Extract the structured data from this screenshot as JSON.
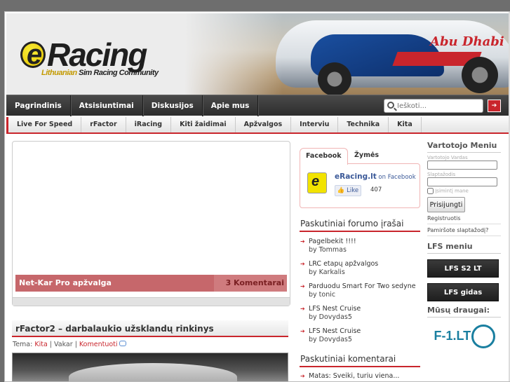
{
  "brand": {
    "logo_word": "Racing",
    "logo_letter": "e",
    "tagline_lt": "Lithuanian",
    "tagline_rest": " Sim Racing Community",
    "header_car_text": "Abu Dhabi",
    "accent_color": "#c9252c"
  },
  "main_nav": {
    "items": [
      "Pagrindinis",
      "Atsisiuntimai",
      "Diskusijos",
      "Apie mus"
    ]
  },
  "search": {
    "placeholder": "Ieškoti...",
    "button_icon": "arrow-right-icon"
  },
  "sub_nav": {
    "items": [
      "Live For Speed",
      "rFactor",
      "iRacing",
      "Kiti žaidimai",
      "Apžvalgos",
      "Interviu",
      "Technika",
      "Kita"
    ]
  },
  "slider": {
    "title": "Net-Kar Pro apžvalga",
    "comments": "3 Komentarai"
  },
  "post": {
    "title": "rFactor2 – darbalaukio užsklandų rinkinys",
    "meta_prefix": "Tema: ",
    "category": "Kita",
    "date": "Vakar",
    "comments_link": "Komentuoti"
  },
  "facebook": {
    "tab_active": "Facebook",
    "tab_other": "Žymės",
    "page_name": "eRacing.lt",
    "on_facebook": " on Facebook",
    "like_label": "Like",
    "like_count": "407"
  },
  "forum": {
    "title": "Paskutiniai forumo įrašai",
    "items": [
      {
        "topic": "Pagelbekit !!!!",
        "by": "by Tommas"
      },
      {
        "topic": "LRC etapų apžvalgos",
        "by": "by Karkalis"
      },
      {
        "topic": "Parduodu Smart For Two sedyne",
        "by": "by tonic"
      },
      {
        "topic": "LFS Nest Cruise",
        "by": "by Dovydas5"
      },
      {
        "topic": "LFS Nest Cruise",
        "by": "by Dovydas5"
      }
    ]
  },
  "comments": {
    "title": "Paskutiniai komentarai",
    "items": [
      {
        "text": "Matas: Sveiki, turiu viena..."
      }
    ]
  },
  "user_menu": {
    "title": "Vartotojo Meniu",
    "username_label": "Vartotojo Vardas",
    "password_label": "Slaptažodis",
    "remember_label": "Įsimintį mane",
    "login_button": "Prisijungti",
    "register_link": "Registruotis",
    "forgot_link": "Pamiršote slaptažodį?"
  },
  "lfs_menu": {
    "title": "LFS meniu",
    "buttons": [
      "LFS S2 LT",
      "LFS gidas"
    ]
  },
  "friends": {
    "title": "Mūsų draugai:",
    "logo_text": "F-1.LT"
  }
}
